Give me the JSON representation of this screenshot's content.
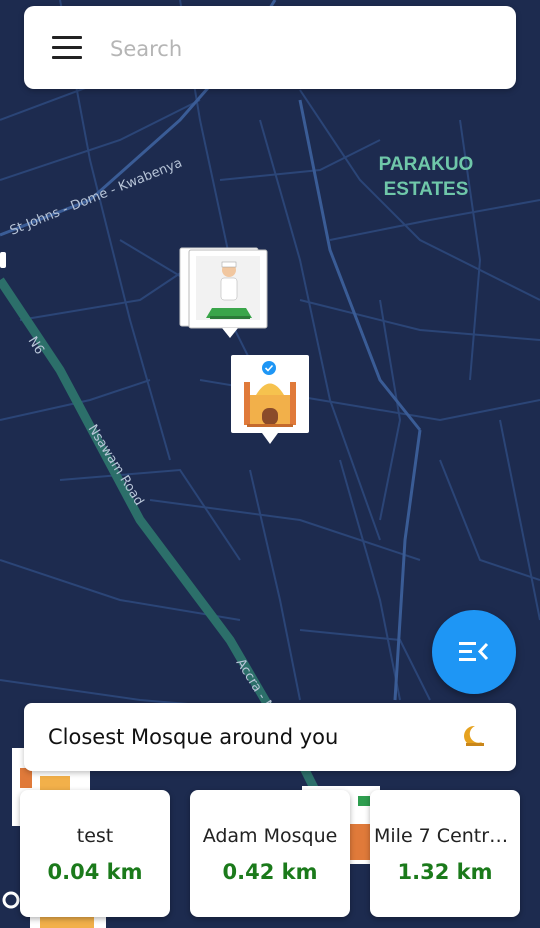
{
  "search": {
    "placeholder": "Search"
  },
  "map": {
    "area_label_line1": "PARAKUO",
    "area_label_line2": "ESTATES",
    "road_labels": [
      "St Johns - Dome - Kwabenya",
      "N6",
      "Nsawam Road",
      "Accra - N"
    ],
    "colors": {
      "background": "#1d2b4f",
      "roads": "#2e4a7e",
      "highway": "#2c6f6a",
      "area_label": "#6fc7a9"
    }
  },
  "closest_panel": {
    "title": "Closest Mosque around you"
  },
  "mosques": [
    {
      "name": "test",
      "distance": "0.04 km"
    },
    {
      "name": "Adam Mosque",
      "distance": "0.42 km"
    },
    {
      "name": "Mile 7 Central ...",
      "distance": "1.32 km"
    }
  ],
  "fab": {
    "icon": "list-collapse-icon",
    "color": "#1e96f5"
  },
  "distance_color": "#1b7a1b"
}
